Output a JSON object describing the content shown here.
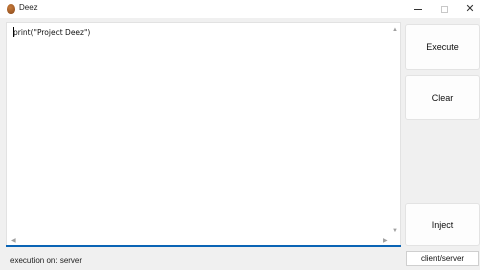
{
  "window": {
    "title": "Deez",
    "close_glyph": "✕"
  },
  "editor": {
    "code": "print(\"Project Deez\")",
    "scroll_up_glyph": "▲",
    "scroll_down_glyph": "▼",
    "scroll_left_glyph": "◀",
    "scroll_right_glyph": "▶"
  },
  "buttons": {
    "execute": "Execute",
    "clear": "Clear",
    "inject": "Inject",
    "mode": "client/server"
  },
  "status": {
    "text": "execution on: server"
  },
  "colors": {
    "accent": "#0a64b5",
    "background": "#f0f0f0"
  }
}
